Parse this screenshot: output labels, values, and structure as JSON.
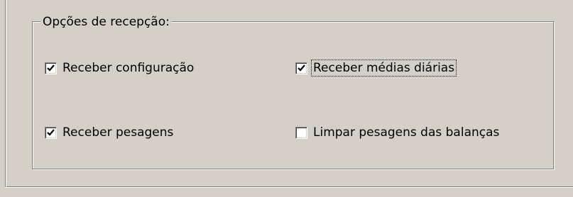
{
  "group": {
    "title": "Opções de recepção:"
  },
  "options": [
    {
      "label": "Receber configuração",
      "checked": true,
      "focused": false
    },
    {
      "label": "Receber médias diárias",
      "checked": true,
      "focused": true
    },
    {
      "label": "Receber pesagens",
      "checked": true,
      "focused": false
    },
    {
      "label": "Limpar pesagens das balanças",
      "checked": false,
      "focused": false
    }
  ],
  "icons": {
    "check": "checkmark-icon"
  }
}
